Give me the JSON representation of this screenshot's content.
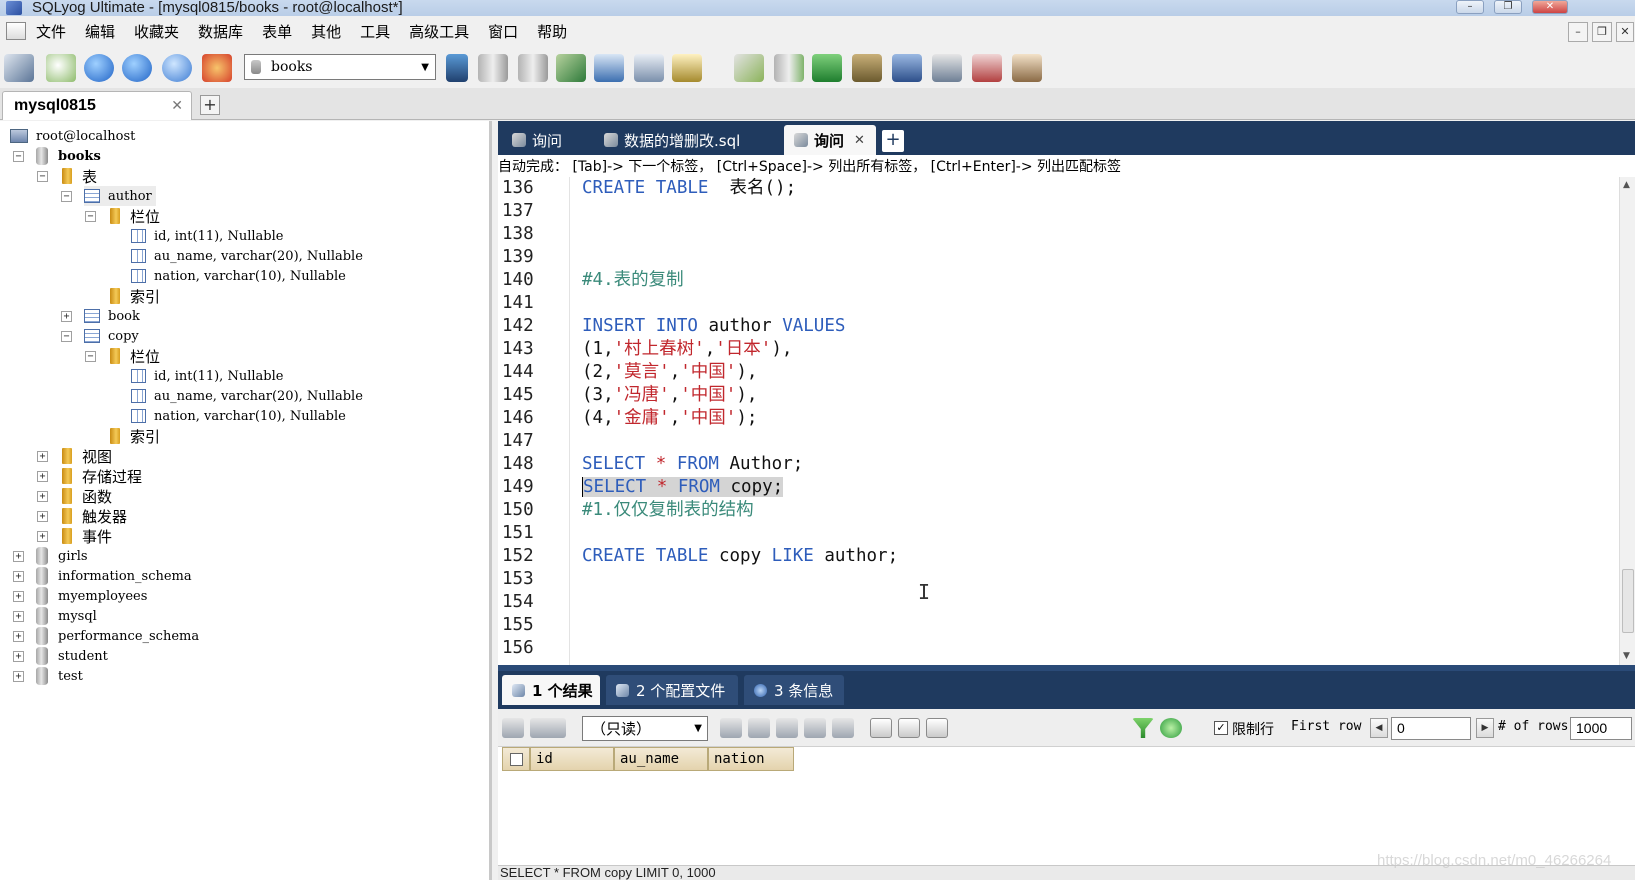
{
  "window": {
    "title": "SQLyog Ultimate - [mysql0815/books - root@localhost*]"
  },
  "menu": [
    "文件",
    "编辑",
    "收藏夹",
    "数据库",
    "表单",
    "其他",
    "工具",
    "高级工具",
    "窗口",
    "帮助"
  ],
  "toolbar": {
    "database_selected": "books"
  },
  "connection_tab": {
    "label": "mysql0815",
    "close": "✕",
    "add": "+"
  },
  "tree": {
    "server": "root@localhost",
    "db_books": "books",
    "tables_folder": "表",
    "author": "author",
    "columns_folder_1": "栏位",
    "author_col_1": "id, int(11), Nullable",
    "author_col_2": "au_name, varchar(20), Nullable",
    "author_col_3": "nation, varchar(10), Nullable",
    "index_folder_1": "索引",
    "book": "book",
    "copy": "copy",
    "columns_folder_2": "栏位",
    "copy_col_1": "id, int(11), Nullable",
    "copy_col_2": "au_name, varchar(20), Nullable",
    "copy_col_3": "nation, varchar(10), Nullable",
    "index_folder_2": "索引",
    "views": "视图",
    "procedures": "存储过程",
    "functions": "函数",
    "triggers": "触发器",
    "events": "事件",
    "other_dbs": [
      "girls",
      "information_schema",
      "myemployees",
      "mysql",
      "performance_schema",
      "student",
      "test"
    ]
  },
  "query_tabs": [
    {
      "label": "询问"
    },
    {
      "label": "数据的增删改.sql"
    },
    {
      "label": "询问",
      "active": true,
      "close": "✕"
    }
  ],
  "autocomplete_hint": "自动完成： [Tab]-> 下一个标签， [Ctrl+Space]-> 列出所有标签， [Ctrl+Enter]-> 列出匹配标签",
  "editor": {
    "line_numbers": [
      "136",
      "137",
      "138",
      "139",
      "140",
      "141",
      "142",
      "143",
      "144",
      "145",
      "146",
      "147",
      "148",
      "149",
      "150",
      "151",
      "152",
      "153",
      "154",
      "155",
      "156"
    ],
    "l136_kw": "CREATE TABLE",
    "l136_rest": "  表名();",
    "l140": "#4.表的复制",
    "l142_kw1": "INSERT INTO",
    "l142_mid": " author ",
    "l142_kw2": "VALUES",
    "l143_a": "(1,",
    "l143_s1": "'村上春树'",
    "l143_b": ",",
    "l143_s2": "'日本'",
    "l143_c": "),",
    "l144_a": "(2,",
    "l144_s1": "'莫言'",
    "l144_b": ",",
    "l144_s2": "'中国'",
    "l144_c": "),",
    "l145_a": "(3,",
    "l145_s1": "'冯唐'",
    "l145_b": ",",
    "l145_s2": "'中国'",
    "l145_c": "),",
    "l146_a": "(4,",
    "l146_s1": "'金庸'",
    "l146_b": ",",
    "l146_s2": "'中国'",
    "l146_c": ");",
    "l148_kw1": "SELECT",
    "l148_star": " * ",
    "l148_kw2": "FROM",
    "l148_rest": " Author;",
    "l149_kw1": "SELECT",
    "l149_star": " * ",
    "l149_kw2": "FROM",
    "l149_rest": " copy;",
    "l150": "#1.仅仅复制表的结构",
    "l152_kw1": "CREATE TABLE",
    "l152_mid": " copy ",
    "l152_kw2": "LIKE",
    "l152_rest": " author;"
  },
  "result_tabs": [
    {
      "label": "1 个结果",
      "active": true
    },
    {
      "label": "2 个配置文件"
    },
    {
      "label": "3 条信息"
    }
  ],
  "result_toolbar": {
    "mode_select": "（只读）",
    "limit_checked": true,
    "limit_label": "限制行",
    "first_row_label": "First row",
    "first_row_value": "0",
    "rows_label": "# of rows",
    "rows_value": "1000"
  },
  "grid_headers": [
    "id",
    "au_name",
    "nation"
  ],
  "status_query": "SELECT * FROM copy LIMIT 0, 1000",
  "watermark": "https://blog.csdn.net/m0_46266264"
}
